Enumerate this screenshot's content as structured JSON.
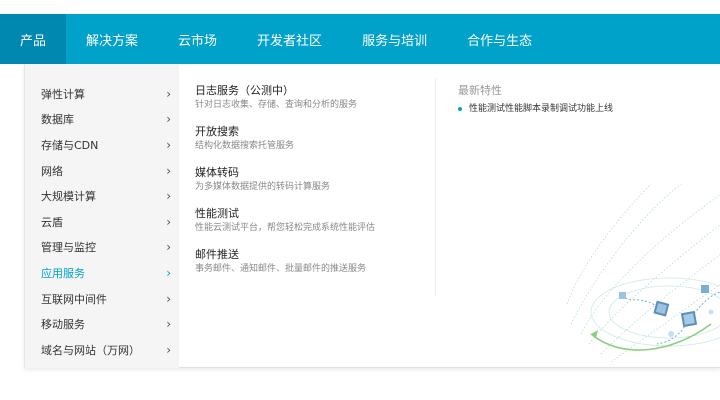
{
  "nav": {
    "items": [
      {
        "label": "产品"
      },
      {
        "label": "解决方案"
      },
      {
        "label": "云市场"
      },
      {
        "label": "开发者社区"
      },
      {
        "label": "服务与培训"
      },
      {
        "label": "合作与生态"
      }
    ],
    "active_index": 0
  },
  "sidebar": {
    "items": [
      {
        "label": "弹性计算",
        "chevron": "›"
      },
      {
        "label": "数据库",
        "chevron": "›"
      },
      {
        "label": "存储与CDN",
        "chevron": "›"
      },
      {
        "label": "网络",
        "chevron": "›"
      },
      {
        "label": "大规模计算",
        "chevron": "›"
      },
      {
        "label": "云盾",
        "chevron": "›"
      },
      {
        "label": "管理与监控",
        "chevron": "›"
      },
      {
        "label": "应用服务",
        "chevron": "›"
      },
      {
        "label": "互联网中间件",
        "chevron": "›"
      },
      {
        "label": "移动服务",
        "chevron": "›"
      },
      {
        "label": "域名与网站（万网）",
        "chevron": "›"
      }
    ],
    "active_index": 7
  },
  "services": [
    {
      "title": "日志服务（公测中）",
      "desc": "针对日志收集、存储、查询和分析的服务"
    },
    {
      "title": "开放搜索",
      "desc": "结构化数据搜索托管服务"
    },
    {
      "title": "媒体转码",
      "desc": "为多媒体数据提供的转码计算服务"
    },
    {
      "title": "性能测试",
      "desc": "性能云测试平台，帮您轻松完成系统性能评估"
    },
    {
      "title": "邮件推送",
      "desc": "事务邮件、通知邮件、批量邮件的推送服务"
    }
  ],
  "features": {
    "heading": "最新特性",
    "items": [
      {
        "text": "性能测试性能脚本录制调试功能上线"
      }
    ]
  },
  "colors": {
    "brand": "#00a2ca",
    "nav_active": "#0088b0",
    "sidebar_bg": "#f5f5f5"
  },
  "icons": {
    "chevron": "chevron-right-icon",
    "bullet": "bullet-icon",
    "decoration": "cloud-network-illustration"
  }
}
